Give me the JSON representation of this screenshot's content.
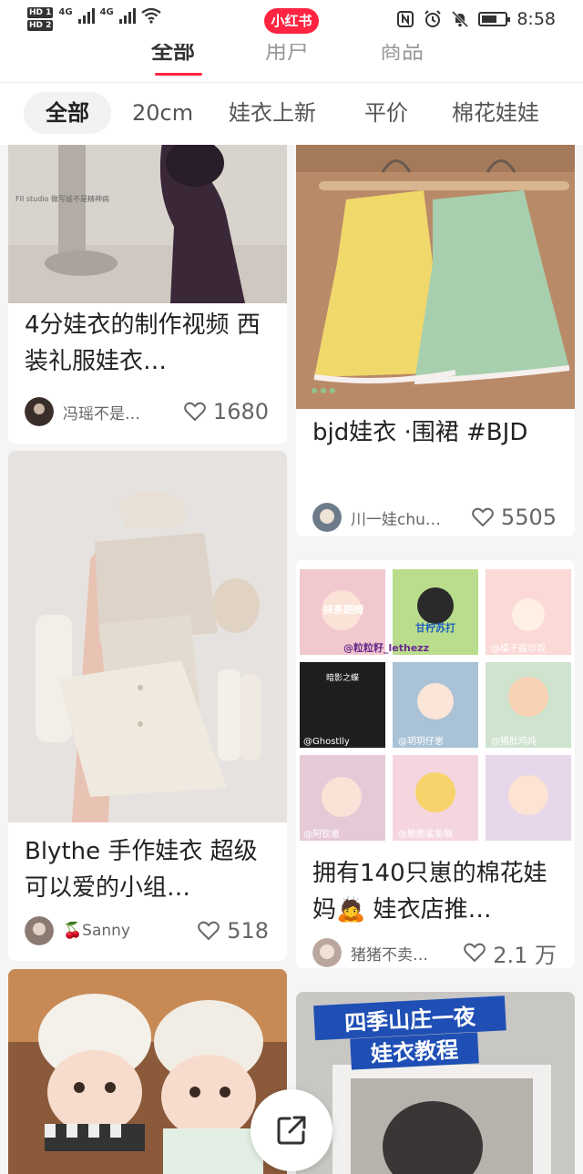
{
  "status_bar": {
    "sim1": "HD 1",
    "sim2": "HD 2",
    "net1": "4G",
    "net2": "4G",
    "app_badge": "小红书",
    "time": "8:58"
  },
  "top_tabs": [
    {
      "label": "全部",
      "active": true
    },
    {
      "label": "用户",
      "active": false
    },
    {
      "label": "商品",
      "active": false
    }
  ],
  "filter_chips": [
    {
      "label": "全部",
      "active": true
    },
    {
      "label": "20cm",
      "active": false
    },
    {
      "label": "娃衣上新",
      "active": false
    },
    {
      "label": "平价",
      "active": false
    },
    {
      "label": "棉花娃娃",
      "active": false
    }
  ],
  "feed": {
    "left": [
      {
        "title": "4分娃衣的制作视频 西装礼服娃衣…",
        "image_caption": "FII studio  做写娃不是精神病",
        "author": "冯瑶不是…",
        "likes": "1680"
      },
      {
        "title": "Blythe 手作娃衣 超级可以爱的小组…",
        "author": "🍒Sanny",
        "likes": "518"
      },
      {
        "title": "",
        "author": "",
        "likes": ""
      }
    ],
    "right": [
      {
        "title": "bjd娃衣 ·围裙 #BJD",
        "author": "川一娃chu…",
        "likes": "5505"
      },
      {
        "title": "拥有140只崽的棉花娃妈🙇 娃衣店推…",
        "author": "猪猪不卖…",
        "likes": "2.1 万",
        "grid_labels": [
          "@粒粒籽_lethezz",
          "@橘子酱炒饭",
          "@Ghostlly",
          "@玥玥仔崽",
          "@猪肚鸡炖",
          "@阿钦崽",
          "@脆脆鲨鱼椒"
        ],
        "grid_texts": [
          "抹茶朗姆",
          "甘柠苏打",
          "暗影之蝶"
        ]
      },
      {
        "title": "",
        "overlay_text_1": "四季山庄一夜",
        "overlay_text_2": "娃衣教程",
        "author": "",
        "likes": ""
      }
    ]
  },
  "share_button": {
    "icon": "share-icon"
  },
  "colors": {
    "brand": "#ff2442",
    "chip_bg": "#f2f2f2"
  }
}
